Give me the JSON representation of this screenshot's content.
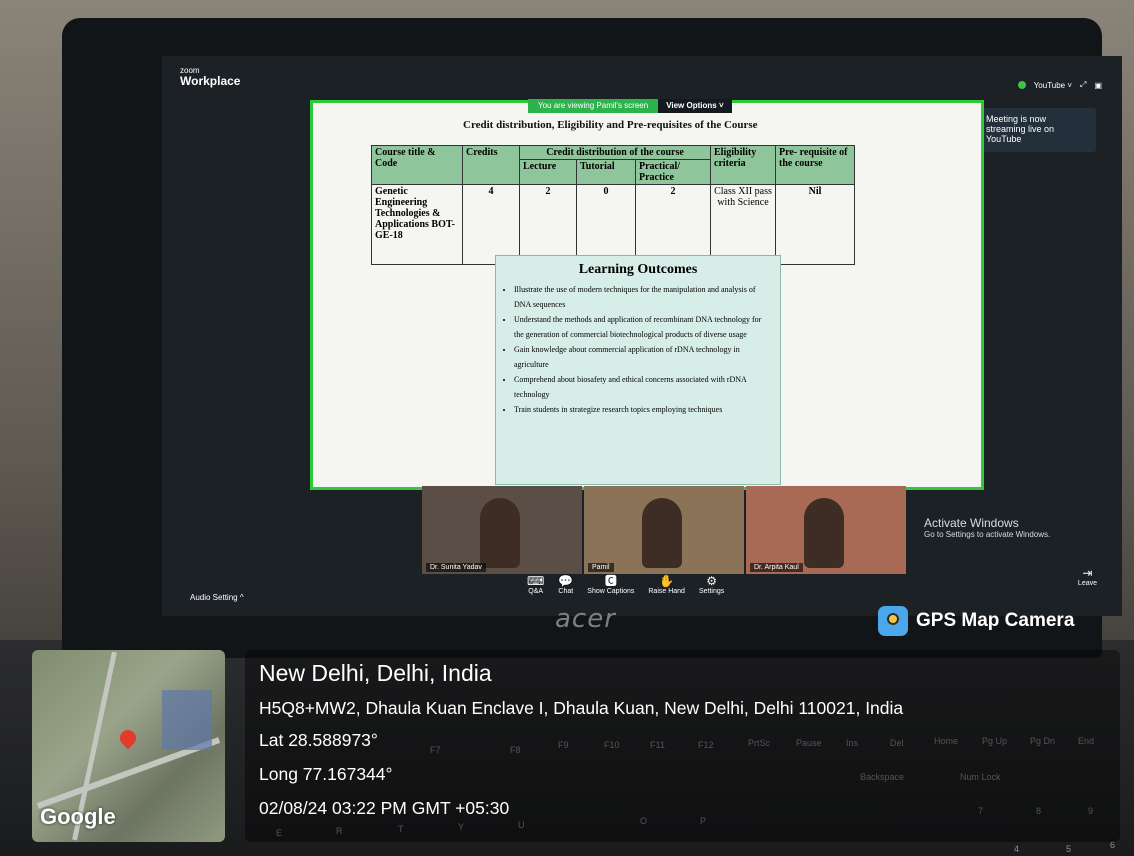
{
  "zoom": {
    "brand_small": "zoom",
    "brand_big": "Workplace",
    "youtube_menu": "YouTube ˅",
    "stream_toast": "Meeting is now streaming live on YouTube",
    "viewing_text": "You are viewing  Pamil's screen",
    "view_options": "View Options ˅",
    "audio_setting": "Audio Setting ^",
    "toolbar": [
      {
        "label": "Q&A",
        "icon": "qa-icon"
      },
      {
        "label": "Chat",
        "icon": "chat-icon"
      },
      {
        "label": "Show Captions",
        "icon": "captions-icon"
      },
      {
        "label": "Raise Hand",
        "icon": "raise-hand-icon"
      },
      {
        "label": "Settings",
        "icon": "gear-icon"
      }
    ],
    "leave": "Leave",
    "participants": [
      "Dr. Sunita Yadav",
      "Pamil",
      "Dr. Arpita Kaul"
    ]
  },
  "slide": {
    "title": "Credit distribution, Eligibility and Pre-requisites of the Course",
    "headers": {
      "course": "Course title & Code",
      "credits": "Credits",
      "distribution": "Credit distribution of the course",
      "lecture": "Lecture",
      "tutorial": "Tutorial",
      "practical": "Practical/ Practice",
      "eligibility": "Eligibility criteria",
      "prereq": "Pre- requisite of the course"
    },
    "row": {
      "course": "Genetic Engineering Technologies & Applications BOT-GE-18",
      "credits": "4",
      "lecture": "2",
      "tutorial": "0",
      "practical": "2",
      "eligibility": "Class XII pass with Science",
      "prereq": "Nil"
    },
    "learning_outcomes_title": "Learning Outcomes",
    "learning_outcomes": [
      "Illustrate the use of modern techniques for the manipulation and analysis of DNA sequences",
      "Understand the methods and application of recombinant DNA technology for the generation of commercial biotechnological products of diverse usage",
      "Gain knowledge about commercial application of rDNA technology in agriculture",
      "Comprehend about biosafety and ethical concerns associated with rDNA technology",
      "Train students in strategize research topics employing techniques"
    ]
  },
  "windows": {
    "activate_title": "Activate Windows",
    "activate_sub": "Go to Settings to activate Windows."
  },
  "laptop": {
    "brand": "acer",
    "keys": [
      "F7",
      "F8",
      "F9",
      "F10",
      "F11",
      "F12",
      "PrtSc",
      "Pause",
      "Ins",
      "Del",
      "Home",
      "Pg Up",
      "Pg Dn",
      "End",
      "Backspace",
      "Num Lock",
      "7",
      "8",
      "9",
      "4",
      "5",
      "6",
      "E",
      "R",
      "T",
      "Y",
      "U",
      "O",
      "P"
    ]
  },
  "gps": {
    "badge": "GPS Map Camera",
    "map_label": "Google",
    "city": "New Delhi, Delhi, India",
    "address": "H5Q8+MW2, Dhaula Kuan Enclave I, Dhaula Kuan, New Delhi, Delhi 110021, India",
    "lat": "Lat 28.588973°",
    "long": "Long 77.167344°",
    "datetime": "02/08/24 03:22 PM GMT +05:30"
  }
}
